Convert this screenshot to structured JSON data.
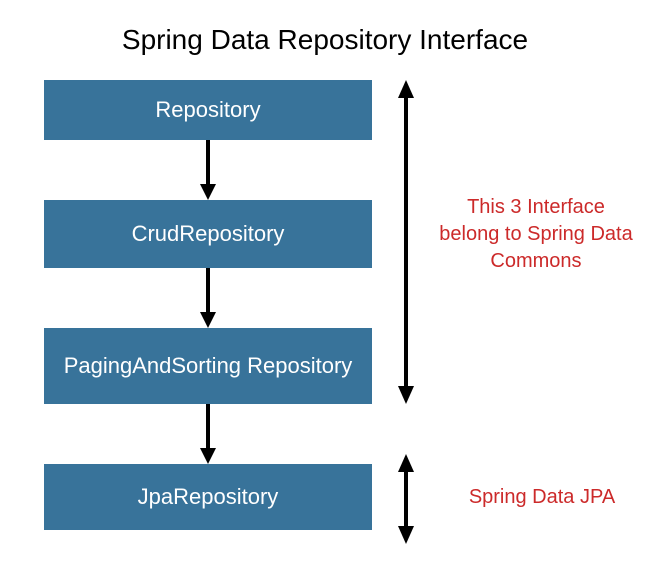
{
  "title": "Spring Data Repository Interface",
  "boxes": [
    {
      "label": "Repository"
    },
    {
      "label": "CrudRepository"
    },
    {
      "label": "PagingAndSorting Repository"
    },
    {
      "label": "JpaRepository"
    }
  ],
  "annotations": [
    {
      "text": "This 3 Interface belong to Spring Data Commons"
    },
    {
      "text": "Spring Data JPA"
    }
  ],
  "colors": {
    "box_bg": "#38739a",
    "box_text": "#ffffff",
    "annotation_text": "#cc2a2a",
    "arrow": "#000000"
  }
}
